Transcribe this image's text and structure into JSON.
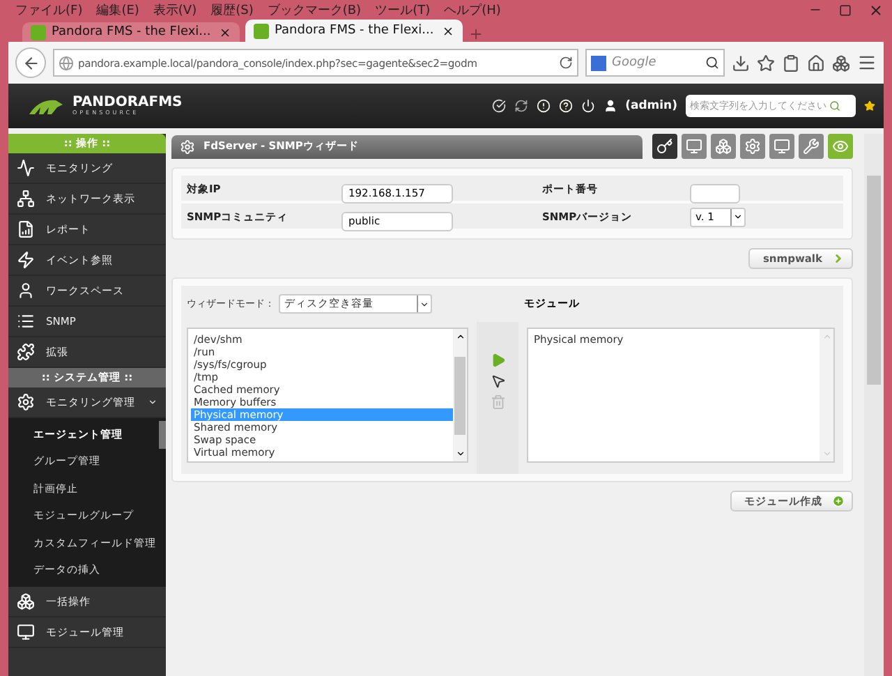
{
  "menu_bar": [
    "ファイル(F)",
    "編集(E)",
    "表示(V)",
    "履歴(S)",
    "ブックマーク(B)",
    "ツール(T)",
    "ヘルプ(H)"
  ],
  "tabs": [
    {
      "title": "Pandora FMS - the Flexi...",
      "selected": false
    },
    {
      "title": "Pandora FMS - the Flexi...",
      "selected": true
    }
  ],
  "address_bar": {
    "url": "pandora.example.local/pandora_console/index.php?sec=gagente&sec2=godm"
  },
  "web_search": {
    "placeholder": "Google"
  },
  "header": {
    "logo": "PANDORAFMS",
    "logo_sub": "OPENSOURCE",
    "user": "(admin)",
    "search_placeholder": "検索文字列を入力してください"
  },
  "sidebar": [
    {
      "title": ":: 操作 ::",
      "kind": "operation",
      "items": [
        {
          "label": "モニタリング"
        },
        {
          "label": "ネットワーク表示"
        },
        {
          "label": "レポート"
        },
        {
          "label": "イベント参照"
        },
        {
          "label": "ワークスペース"
        },
        {
          "label": "SNMP"
        },
        {
          "label": "拡張"
        }
      ]
    },
    {
      "title": ":: システム管理 ::",
      "kind": "admin",
      "items": [
        {
          "label": "モニタリング管理",
          "expanded": true,
          "children": [
            {
              "label": "エージェント管理",
              "selected": true
            },
            {
              "label": "グループ管理",
              "selected": false
            },
            {
              "label": "計画停止",
              "selected": false
            },
            {
              "label": "モジュールグループ",
              "selected": false
            },
            {
              "label": "カスタムフィールド管理",
              "selected": false
            },
            {
              "label": "データの挿入",
              "selected": false
            }
          ]
        },
        {
          "label": "一括操作",
          "expanded": false
        },
        {
          "label": "モジュール管理",
          "expanded": false
        }
      ]
    }
  ],
  "page": {
    "title": "FdServer - SNMPウィザード",
    "form": [
      {
        "label": "対象IP",
        "value": "192.168.1.157",
        "label2": "ポート番号"
      },
      {
        "label": "SNMPコミュニティ",
        "value": "public",
        "label2": "SNMPバージョン",
        "select2": "v. 1"
      }
    ],
    "snmpwalk_button": "snmpwalk",
    "wizard_mode_label": "ウィザードモード：",
    "wizard_mode": "ディスク空き容量",
    "modules_label": "モジュール",
    "available": [
      {
        "label": "/dev/shm",
        "selected": false
      },
      {
        "label": "/run",
        "selected": false
      },
      {
        "label": "/sys/fs/cgroup",
        "selected": false
      },
      {
        "label": "/tmp",
        "selected": false
      },
      {
        "label": "Cached memory",
        "selected": false
      },
      {
        "label": "Memory buffers",
        "selected": false
      },
      {
        "label": "Physical memory",
        "selected": true
      },
      {
        "label": "Shared memory",
        "selected": false
      },
      {
        "label": "Swap space",
        "selected": false
      },
      {
        "label": "Virtual memory",
        "selected": false
      }
    ],
    "chosen": [
      "Physical memory"
    ],
    "create_button": "モジュール作成"
  }
}
